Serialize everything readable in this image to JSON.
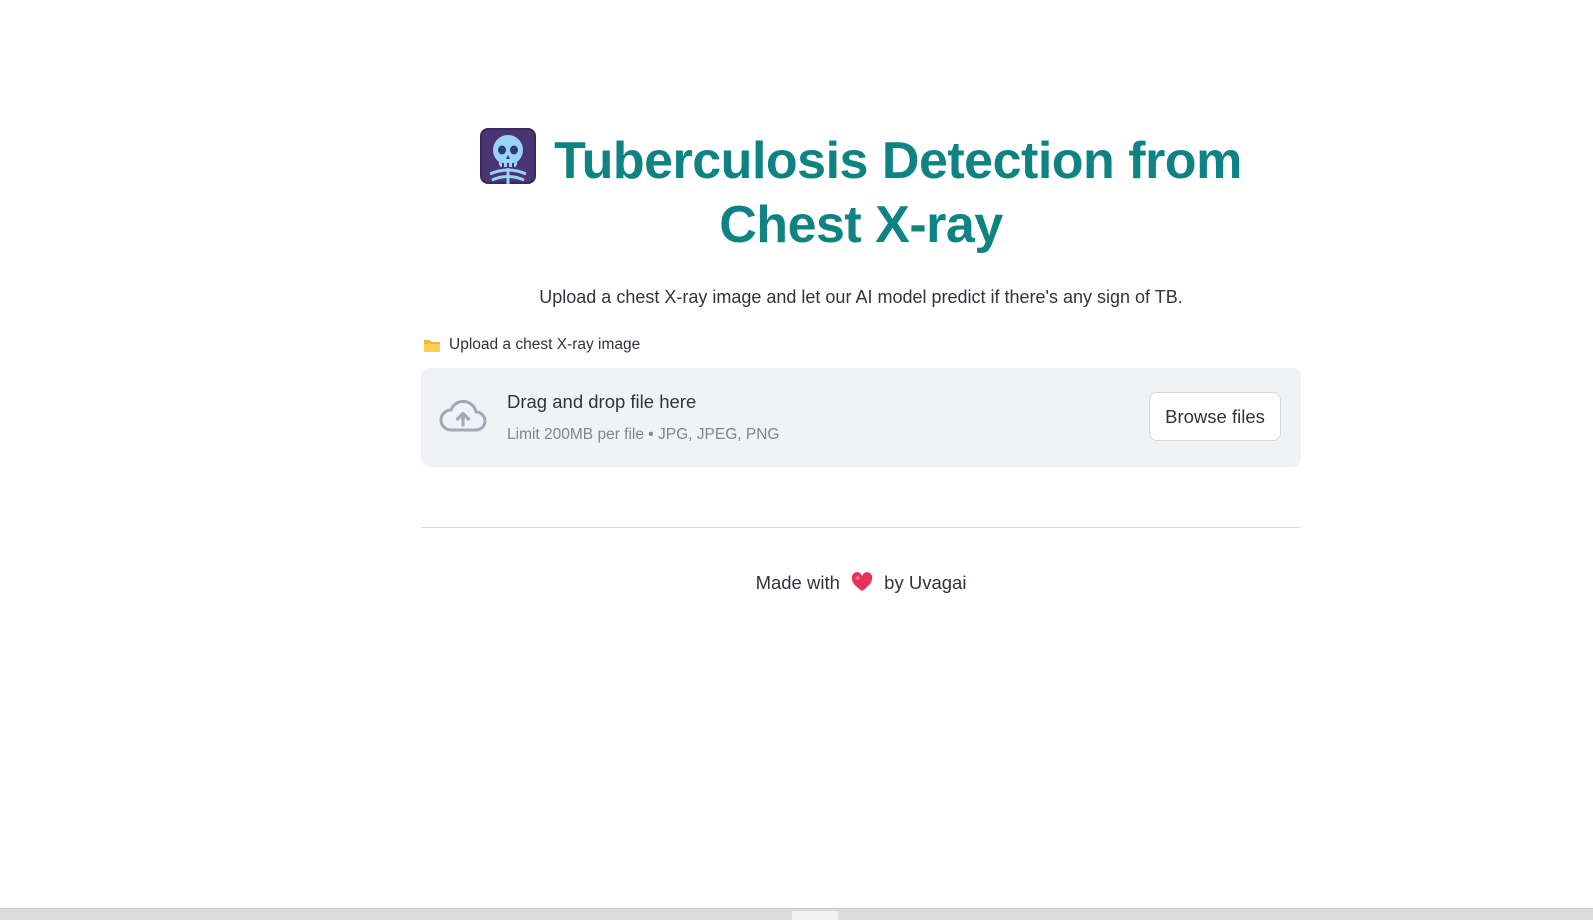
{
  "header": {
    "icon": "x-ray-skeleton-icon",
    "title": "Tuberculosis Detection from Chest X-ray"
  },
  "subtitle": "Upload a chest X-ray image and let our AI model predict if there's any sign of TB.",
  "uploader": {
    "icon": "folder-icon",
    "label": "Upload a chest X-ray image",
    "dropzone": {
      "icon": "cloud-upload-icon",
      "title": "Drag and drop file here",
      "limit_text": "Limit 200MB per file • JPG, JPEG, PNG",
      "browse_label": "Browse files"
    }
  },
  "footer": {
    "prefix": "Made with",
    "icon": "heart-icon",
    "suffix": "by Uvagai"
  },
  "colors": {
    "title": "#0f8381",
    "text": "#31333f",
    "muted": "#808495",
    "dropzone_bg": "#f0f2f6",
    "heart": "#e8305a"
  }
}
